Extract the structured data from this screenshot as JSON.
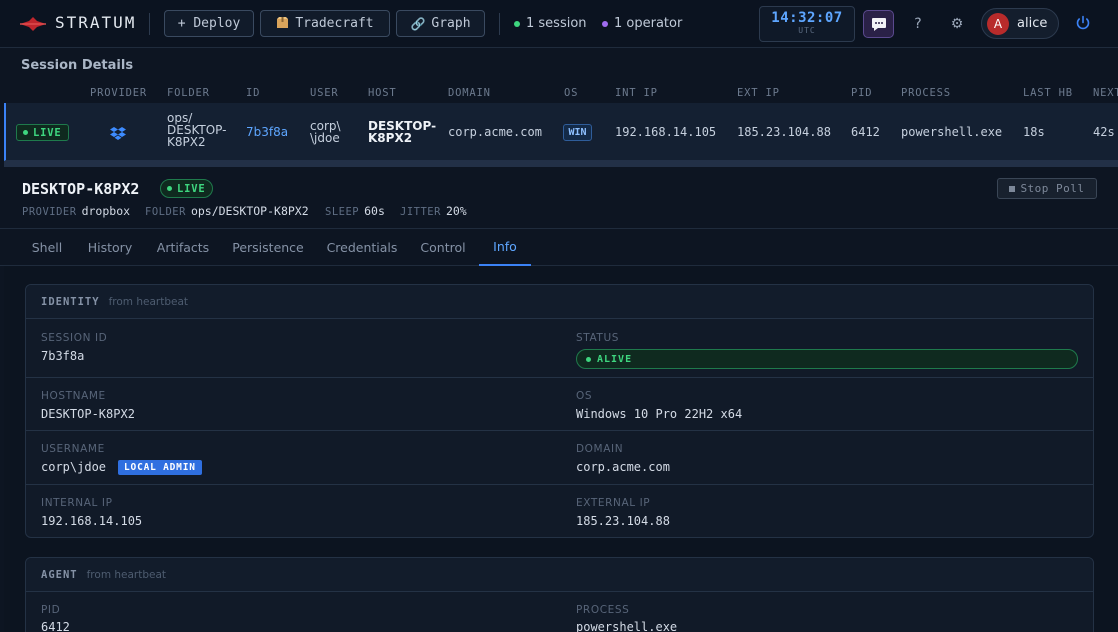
{
  "app": {
    "name": "STRATUM",
    "buttons": {
      "deploy": "+ Deploy",
      "tradecraft": "Tradecraft",
      "graph": "Graph"
    },
    "status": {
      "sessions": "1 session",
      "operators": "1 operator"
    },
    "clock": {
      "time": "14:32:07",
      "zone": "UTC"
    },
    "help": "?",
    "user": {
      "initial": "A",
      "name": "alice"
    }
  },
  "session_details": {
    "title": "Session Details",
    "columns": [
      "PROVIDER",
      "FOLDER",
      "ID",
      "USER",
      "HOST",
      "DOMAIN",
      "OS",
      "INT IP",
      "EXT IP",
      "PID",
      "PROCESS",
      "LAST HB",
      "NEXT"
    ],
    "row": {
      "status": "LIVE",
      "provider_icon": "dropbox-icon",
      "folder_lines": [
        "ops/",
        "DESKTOP-",
        "K8PX2"
      ],
      "id": "7b3f8a",
      "user_lines": [
        "corp\\",
        "\\jdoe"
      ],
      "host_lines": [
        "DESKTOP-",
        "K8PX2"
      ],
      "domain": "corp.acme.com",
      "os": "WIN",
      "int_ip": "192.168.14.105",
      "ext_ip": "185.23.104.88",
      "pid": "6412",
      "process": "powershell.exe",
      "last_hb": "18s",
      "next": "42s"
    }
  },
  "detail": {
    "host": "DESKTOP-K8PX2",
    "status": "LIVE",
    "meta": [
      {
        "k": "PROVIDER",
        "v": "dropbox"
      },
      {
        "k": "FOLDER",
        "v": "ops/DESKTOP-K8PX2"
      },
      {
        "k": "SLEEP",
        "v": "60s"
      },
      {
        "k": "JITTER",
        "v": "20%"
      }
    ],
    "stop_poll": "Stop Poll",
    "tabs": [
      "Shell",
      "History",
      "Artifacts",
      "Persistence",
      "Credentials",
      "Control",
      "Info"
    ],
    "active_tab": "Info"
  },
  "identity": {
    "title": "IDENTITY",
    "subtitle": "from heartbeat",
    "session_id": {
      "label": "SESSION ID",
      "value": "7b3f8a"
    },
    "status": {
      "label": "STATUS",
      "value": "ALIVE"
    },
    "hostname": {
      "label": "HOSTNAME",
      "value": "DESKTOP-K8PX2"
    },
    "os": {
      "label": "OS",
      "value": "Windows 10 Pro 22H2 x64"
    },
    "username": {
      "label": "USERNAME",
      "value": "corp\\jdoe",
      "badge": "LOCAL ADMIN"
    },
    "domain": {
      "label": "DOMAIN",
      "value": "corp.acme.com"
    },
    "internal_ip": {
      "label": "INTERNAL IP",
      "value": "192.168.14.105"
    },
    "external_ip": {
      "label": "EXTERNAL IP",
      "value": "185.23.104.88"
    }
  },
  "agent": {
    "title": "AGENT",
    "subtitle": "from heartbeat",
    "pid": {
      "label": "PID",
      "value": "6412"
    },
    "process": {
      "label": "PROCESS",
      "value": "powershell.exe"
    }
  },
  "colors": {
    "accent": "#3b82f6",
    "live": "#3ed67f",
    "brand": "#c0262d",
    "chat": "#2a2147"
  }
}
